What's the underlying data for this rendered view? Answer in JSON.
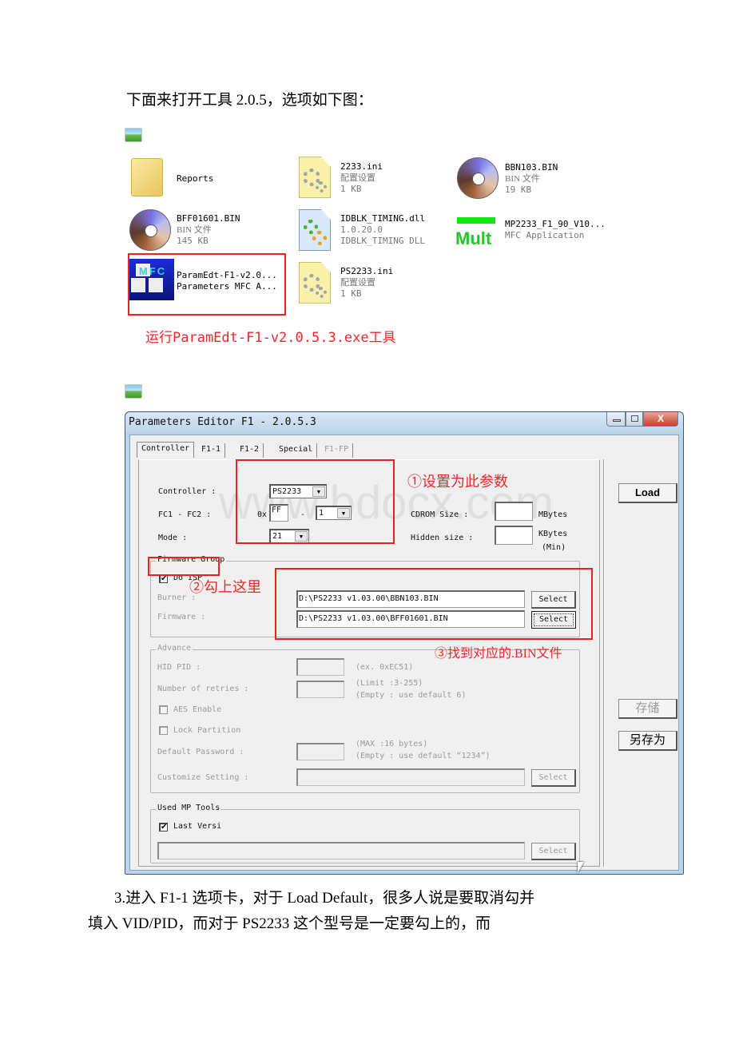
{
  "intro": {
    "text": "下面来打开工具 2.0.5，选项如下图："
  },
  "explorer": {
    "files": [
      {
        "name": "Reports",
        "type": "",
        "size": "",
        "icon": "folder-icon"
      },
      {
        "name": "2233.ini",
        "type": "配置设置",
        "size": "1 KB",
        "icon": "ini-file-icon"
      },
      {
        "name": "BBN103.BIN",
        "type": "BIN 文件",
        "size": "19 KB",
        "icon": "cd-disc-icon"
      },
      {
        "name": "BFF01601.BIN",
        "type": "BIN 文件",
        "size": "145 KB",
        "icon": "cd-disc-icon"
      },
      {
        "name": "IDBLK_TIMING.dll",
        "type": "1.0.20.0",
        "size": "IDBLK_TIMING DLL",
        "icon": "dll-file-icon"
      },
      {
        "name": "MP2233_F1_90_V10...",
        "type": "MFC Application",
        "size": "",
        "icon": "mult-app-icon",
        "icon_text": "Mult"
      },
      {
        "name": "ParamEdt-F1-v2.0...",
        "type": "Parameters MFC A...",
        "size": "",
        "icon": "mfc-app-icon",
        "icon_text": "MFC"
      },
      {
        "name": "PS2233.ini",
        "type": "配置设置",
        "size": "1 KB",
        "icon": "ini-file-icon"
      }
    ],
    "annotation": "运行ParamEdt-F1-v2.0.5.3.exe工具"
  },
  "window": {
    "title": "Parameters Editor F1 - 2.0.5.3",
    "tabs": [
      {
        "label": "Controller",
        "active": true,
        "enabled": true
      },
      {
        "label": "F1-1",
        "active": false,
        "enabled": true
      },
      {
        "label": "F1-2",
        "active": false,
        "enabled": true
      },
      {
        "label": "Special",
        "active": false,
        "enabled": true
      },
      {
        "label": "F1-FP",
        "active": false,
        "enabled": false
      }
    ],
    "controller": {
      "controller_label": "Controller :",
      "controller_value": "PS2233",
      "fc_label": "FC1 - FC2 :",
      "fc_prefix": "0x",
      "fc1_value": "FF",
      "fc_dash": "-",
      "fc2_value": "1",
      "mode_label": "Mode :",
      "mode_value": "21",
      "cdrom_label": "CDROM Size :",
      "cdrom_value": "",
      "cdrom_unit": "MBytes",
      "hidden_label": "Hidden size :",
      "hidden_value": "",
      "hidden_unit": "KBytes",
      "hidden_unit2": "(Min)"
    },
    "firmware_group": {
      "title": "Firmware Group",
      "do_isp_label": "Do ISP",
      "do_isp_checked": true,
      "burner_label": "Burner :",
      "burner_value": "D:\\PS2233 v1.03.00\\BBN103.BIN",
      "firmware_label": "Firmware :",
      "firmware_value": "D:\\PS2233 v1.03.00\\BFF01601.BIN",
      "select_label": "Select"
    },
    "advance": {
      "title": "Advance",
      "hid_pid_label": "HID PID :",
      "hid_pid_hint": "(ex. 0xEC51)",
      "retries_label": "Number of retries :",
      "retries_hint1": "(Limit :3-255)",
      "retries_hint2": "(Empty : use default 6)",
      "aes_label": "AES Enable",
      "aes_checked": false,
      "lock_label": "Lock Partition",
      "lock_checked": false,
      "password_label": "Default Password :",
      "password_hint1": "(MAX :16 bytes)",
      "password_hint2": "(Empty : use default “1234”)",
      "customize_label": "Customize Setting :",
      "select_label": "Select"
    },
    "mp_tools": {
      "title": "Used MP Tools",
      "last_label": "Last Versi",
      "last_checked": true,
      "path_value": "",
      "select_label": "Select"
    },
    "side_buttons": {
      "load": "Load",
      "save": "存储",
      "save_as": "另存为"
    },
    "annotations": {
      "step1": "①设置为此参数",
      "step2": "②勾上这里",
      "step3": "③找到对应的.BIN文件"
    },
    "watermark": "www.bdocx.com"
  },
  "body_text": {
    "line1": "3.进入 F1-1 选项卡，对于 Load Default，很多人说是要取消勾并",
    "line2": "填入 VID/PID，而对于 PS2233 这个型号是一定要勾上的，而"
  }
}
